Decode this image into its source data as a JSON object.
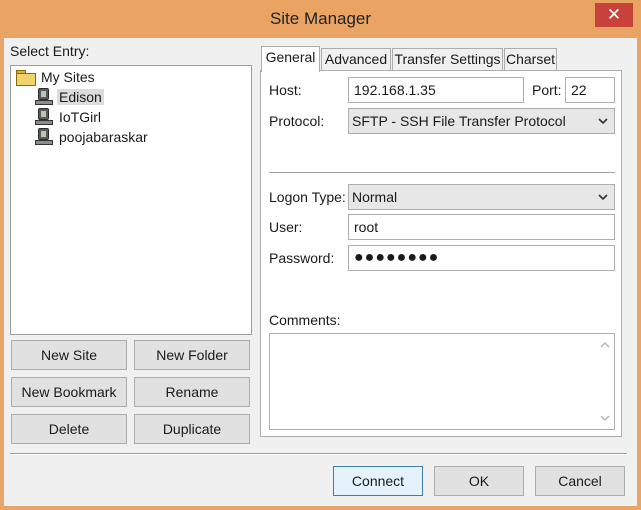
{
  "window": {
    "title": "Site Manager",
    "close_symbol": "✕"
  },
  "entry": {
    "label": "Select Entry:",
    "root_folder": "My Sites",
    "sites": [
      "Edison",
      "IoTGirl",
      "poojabaraskar"
    ],
    "selected_site": "Edison"
  },
  "left_buttons": {
    "new_site": "New Site",
    "new_folder": "New Folder",
    "new_bookmark": "New Bookmark",
    "rename": "Rename",
    "delete": "Delete",
    "duplicate": "Duplicate"
  },
  "tabs": [
    "General",
    "Advanced",
    "Transfer Settings",
    "Charset"
  ],
  "active_tab": "General",
  "general": {
    "host_label": "Host:",
    "host_value": "192.168.1.35",
    "port_label": "Port:",
    "port_value": "22",
    "protocol_label": "Protocol:",
    "protocol_value": "SFTP - SSH File Transfer Protocol",
    "logon_type_label": "Logon Type:",
    "logon_type_value": "Normal",
    "user_label": "User:",
    "user_value": "root",
    "password_label": "Password:",
    "password_value": "●●●●●●●●",
    "comments_label": "Comments:"
  },
  "footer_buttons": {
    "connect": "Connect",
    "ok": "OK",
    "cancel": "Cancel"
  },
  "icons": {
    "folder": "folder-open-icon",
    "site": "server-icon",
    "dropdown": "chevron-down-icon",
    "close": "close-icon"
  },
  "colors": {
    "titlebar": "#e9a463",
    "close_button": "#c6423a",
    "default_button_border": "#3c7fb1"
  }
}
